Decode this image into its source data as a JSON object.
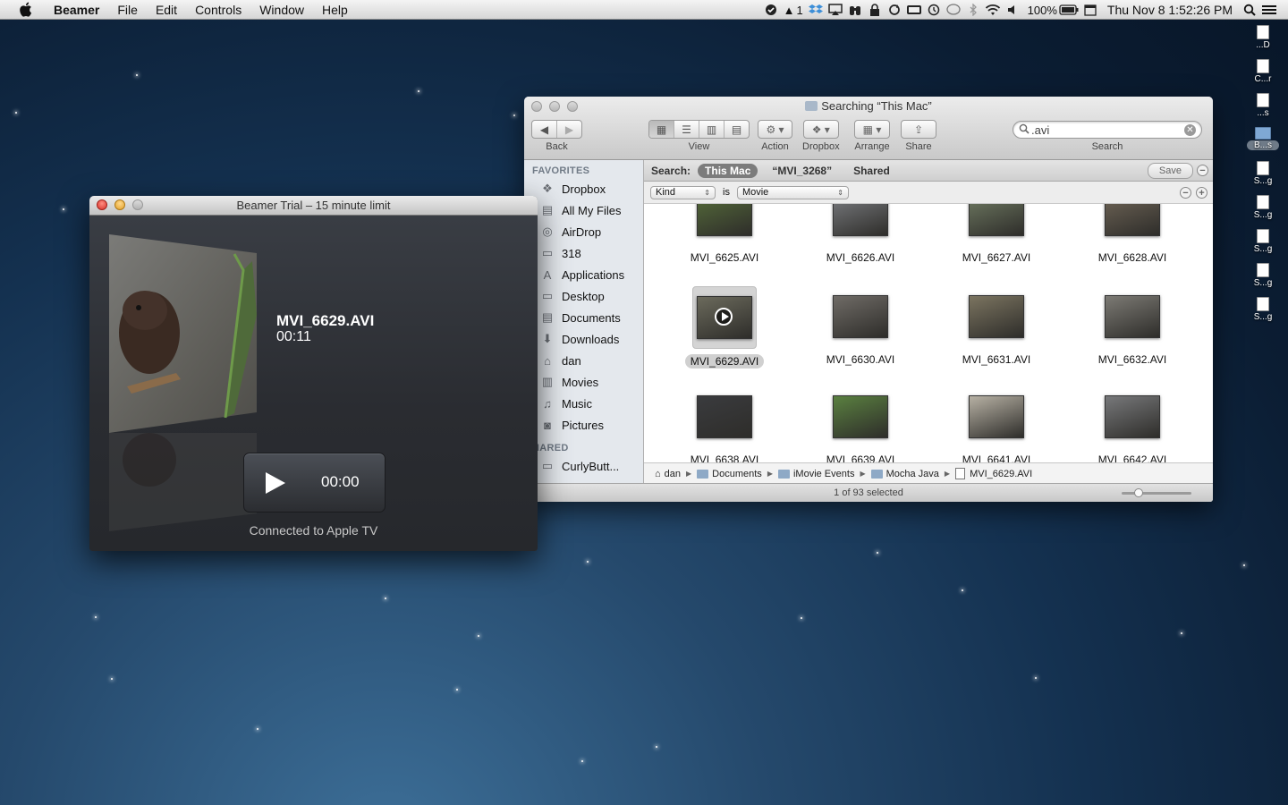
{
  "menubar": {
    "app": "Beamer",
    "menus": [
      "File",
      "Edit",
      "Controls",
      "Window",
      "Help"
    ],
    "notification_count": "1",
    "battery": "100%",
    "clock": "Thu Nov 8  1:52:26 PM"
  },
  "desktop_icons": [
    "...D",
    "C...r",
    "...s",
    "B...s",
    "S...g",
    "S...g",
    "S...g",
    "S...g",
    "S...g"
  ],
  "finder": {
    "title": "Searching “This Mac”",
    "toolbar": {
      "back_label": "Back",
      "view_label": "View",
      "action_label": "Action",
      "dropbox_label": "Dropbox",
      "arrange_label": "Arrange",
      "share_label": "Share",
      "search_label": "Search",
      "search_value": ".avi"
    },
    "sidebar": {
      "favorites_header": "FAVORITES",
      "items": [
        "Dropbox",
        "All My Files",
        "AirDrop",
        "318",
        "Applications",
        "Desktop",
        "Documents",
        "Downloads",
        "dan",
        "Movies",
        "Music",
        "Pictures"
      ],
      "shared_header": "HARED",
      "shared_items": [
        "CurlyButt..."
      ]
    },
    "searchbar": {
      "label": "Search:",
      "scopes": [
        "This Mac",
        "“MVI_3268”",
        "Shared"
      ],
      "save_label": "Save"
    },
    "criteria": {
      "attribute": "Kind",
      "operator": "is",
      "value": "Movie"
    },
    "files": [
      {
        "name": "MVI_6625.AVI",
        "color": "#556b3a"
      },
      {
        "name": "MVI_6626.AVI",
        "color": "#7a7c80"
      },
      {
        "name": "MVI_6627.AVI",
        "color": "#6f7a62"
      },
      {
        "name": "MVI_6628.AVI",
        "color": "#6e6456"
      },
      {
        "name": "MVI_6629.AVI",
        "color": "#6b6a5c"
      },
      {
        "name": "MVI_6630.AVI",
        "color": "#6f6b66"
      },
      {
        "name": "MVI_6631.AVI",
        "color": "#7b7460"
      },
      {
        "name": "MVI_6632.AVI",
        "color": "#7c7a74"
      },
      {
        "name": "MVI_6638.AVI",
        "color": "#3a3b3e"
      },
      {
        "name": "MVI_6639.AVI",
        "color": "#5a8040"
      },
      {
        "name": "MVI_6641.AVI",
        "color": "#b7b1a4"
      },
      {
        "name": "MVI_6642.AVI",
        "color": "#77787a"
      }
    ],
    "selected_file": "MVI_6629.AVI",
    "path": [
      "dan",
      "Documents",
      "iMovie Events",
      "Mocha Java",
      "MVI_6629.AVI"
    ],
    "status": "1 of 93 selected"
  },
  "beamer": {
    "title": "Beamer Trial – 15 minute limit",
    "movie_title": "MVI_6629.AVI",
    "duration": "00:11",
    "timecode": "00:00",
    "connection": "Connected to Apple TV"
  }
}
